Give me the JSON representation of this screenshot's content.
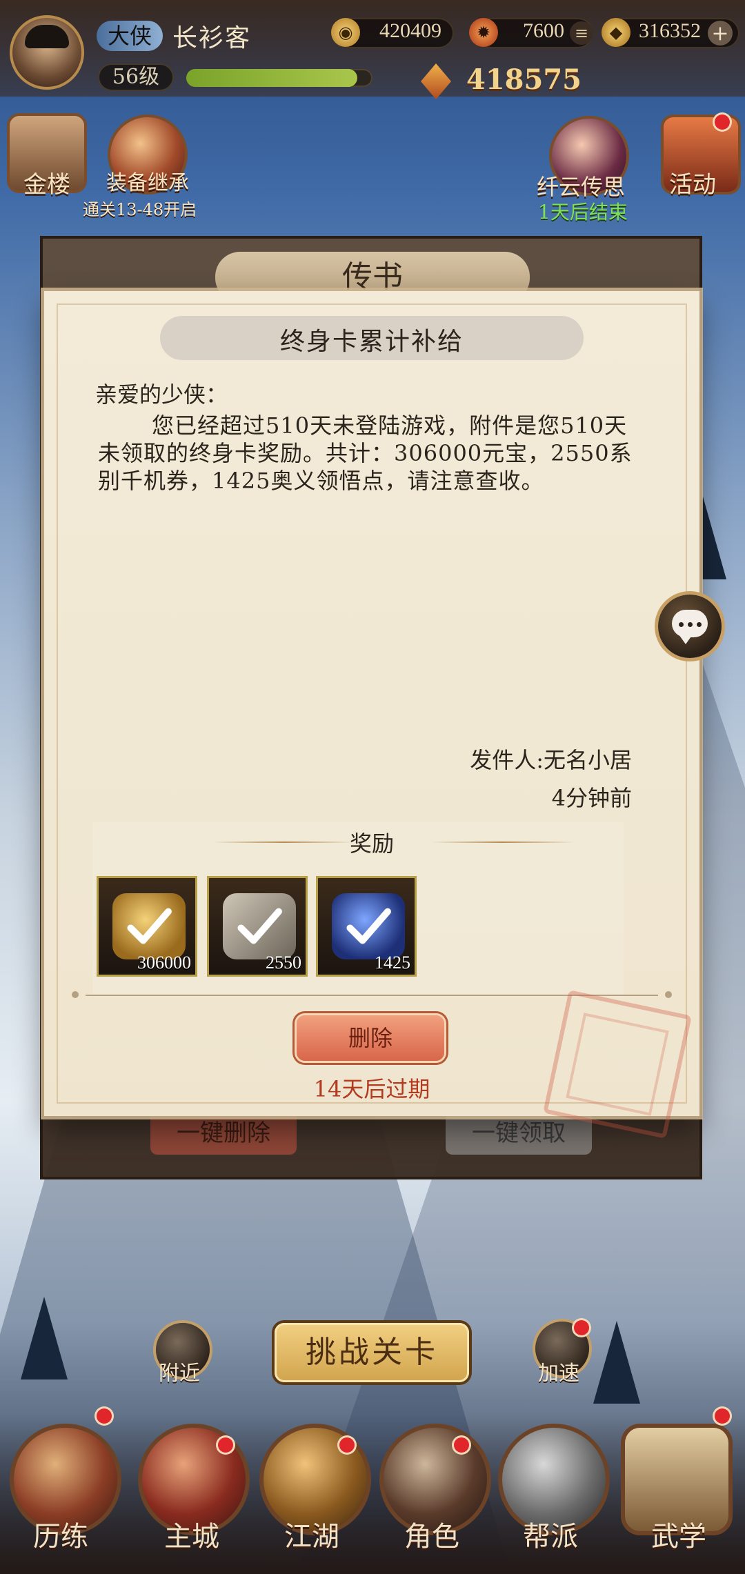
{
  "hud": {
    "player_rank": "大侠",
    "player_name": "长衫客",
    "level": "56级",
    "exp_fraction": 0.92,
    "coins": "420409",
    "stamina": "7600",
    "ingots": "316352",
    "power": "418575"
  },
  "features": {
    "gold_tower": "金楼",
    "equip_inherit": "装备继承",
    "equip_inherit_sub": "通关13-48开启",
    "event_name": "纤云传思",
    "event_status": "1天后结束",
    "activity": "活动"
  },
  "mail_window": {
    "title": "传书",
    "delete_all": "一键删除",
    "claim_all": "一键领取"
  },
  "letter": {
    "title": "终身卡累计补给",
    "greeting": "亲爱的少侠：",
    "body": "您已经超过510天未登陆游戏，附件是您510天未领取的终身卡奖励。共计：306000元宝，2550系别千机券，1425奥义领悟点，请注意查收。",
    "sender": "发件人:无名小居",
    "time": "4分钟前",
    "rewards_title": "奖励",
    "rewards": [
      {
        "icon": "gold-ingot-icon",
        "count": "306000"
      },
      {
        "icon": "ticket-icon",
        "count": "2550"
      },
      {
        "icon": "insight-orb-icon",
        "count": "1425"
      }
    ],
    "delete_label": "删除",
    "expire": "14天后过期"
  },
  "bottom": {
    "challenge": "挑战关卡",
    "nearby": "附近",
    "speedup": "加速",
    "nav": [
      "历练",
      "主城",
      "江湖",
      "角色",
      "帮派",
      "武学"
    ]
  },
  "colors": {
    "accent_red": "#b33a1f",
    "gold": "#f2d38c",
    "parchment": "#f3ebd8"
  }
}
